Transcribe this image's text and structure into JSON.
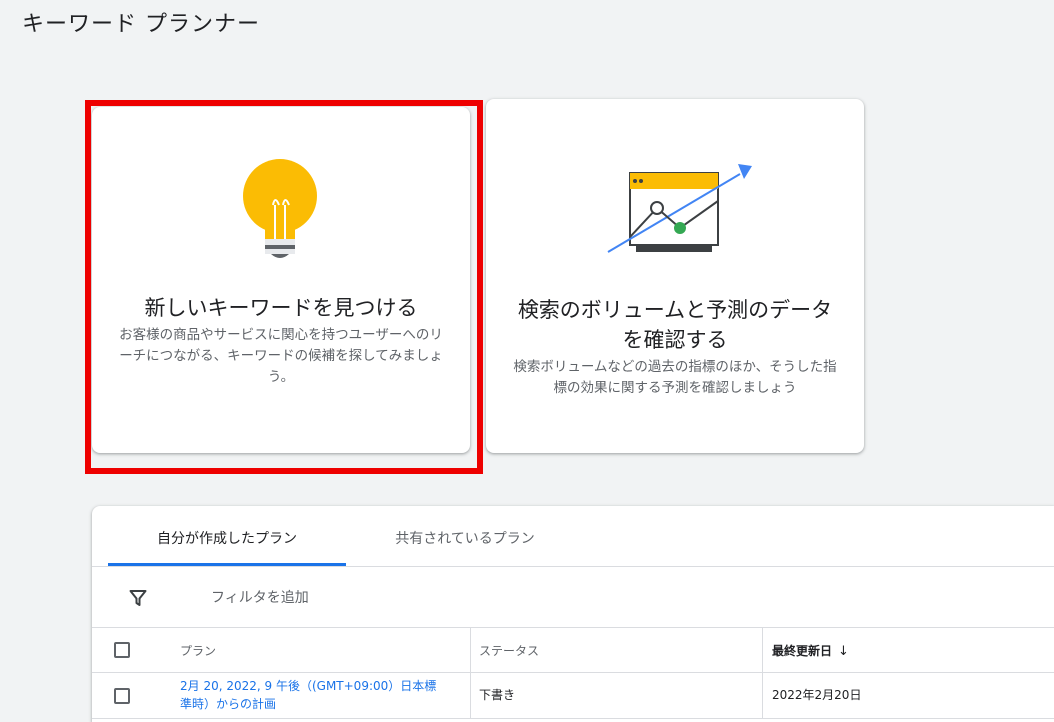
{
  "page": {
    "title": "キーワード プランナー"
  },
  "cards": {
    "find": {
      "title": "新しいキーワードを見つける",
      "description": "お客様の商品やサービスに関心を持つユーザーへのリーチにつながる、キーワードの候補を探してみましょう。"
    },
    "forecast": {
      "title": "検索のボリュームと予測のデータを確認する",
      "description": "検索ボリュームなどの過去の指標のほか、そうした指標の効果に関する予測を確認しましょう"
    }
  },
  "plans": {
    "tabs": [
      "自分が作成したプラン",
      "共有されているプラン"
    ],
    "active_tab": 0,
    "filter_label": "フィルタを追加",
    "columns": {
      "plan": "プラン",
      "status": "ステータス",
      "updated": "最終更新日",
      "updated_sort": "↓"
    },
    "rows": [
      {
        "plan": "2月 20, 2022, 9 午後（(GMT+09:00）日本標準時）からの計画",
        "status": "下書き",
        "updated": "2022年2月20日"
      }
    ]
  },
  "colors": {
    "accent": "#1a73e8",
    "highlight": "#ee0000",
    "bulb": "#fbbc04",
    "point": "#34a853"
  },
  "icons": {
    "bulb": "lightbulb-icon",
    "chart": "trend-chart-icon",
    "filter": "filter-icon",
    "sort": "arrow-down-icon"
  }
}
